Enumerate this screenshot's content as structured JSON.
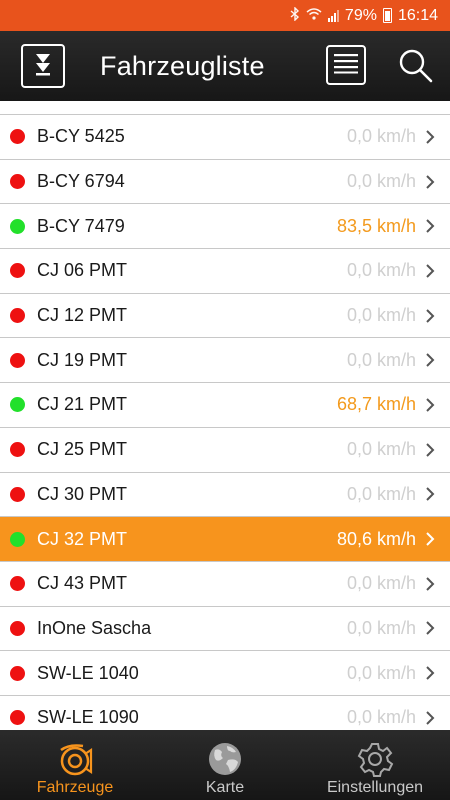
{
  "statusbar": {
    "battery": "79%",
    "time": "16:14"
  },
  "appbar": {
    "title": "Fahrzeugliste"
  },
  "vehicles": [
    {
      "name": "B-CY 5425",
      "speed": "0,0 km/h",
      "status": "stopped"
    },
    {
      "name": "B-CY 6794",
      "speed": "0,0 km/h",
      "status": "stopped"
    },
    {
      "name": "B-CY 7479",
      "speed": "83,5 km/h",
      "status": "moving"
    },
    {
      "name": "CJ 06 PMT",
      "speed": "0,0 km/h",
      "status": "stopped"
    },
    {
      "name": "CJ 12 PMT",
      "speed": "0,0 km/h",
      "status": "stopped"
    },
    {
      "name": "CJ 19 PMT",
      "speed": "0,0 km/h",
      "status": "stopped"
    },
    {
      "name": "CJ 21 PMT",
      "speed": "68,7 km/h",
      "status": "moving"
    },
    {
      "name": "CJ 25 PMT",
      "speed": "0,0 km/h",
      "status": "stopped"
    },
    {
      "name": "CJ 30 PMT",
      "speed": "0,0 km/h",
      "status": "stopped"
    },
    {
      "name": "CJ 32 PMT",
      "speed": "80,6 km/h",
      "status": "moving",
      "selected": true
    },
    {
      "name": "CJ 43 PMT",
      "speed": "0,0 km/h",
      "status": "stopped"
    },
    {
      "name": "InOne Sascha",
      "speed": "0,0 km/h",
      "status": "stopped"
    },
    {
      "name": "SW-LE 1040",
      "speed": "0,0 km/h",
      "status": "stopped"
    },
    {
      "name": "SW-LE 1090",
      "speed": "0,0 km/h",
      "status": "stopped"
    }
  ],
  "status_colors": {
    "moving": "#22e02b",
    "stopped": "#ee1111"
  },
  "accent_color": "#f7941d",
  "bottomnav": {
    "tabs": [
      {
        "label": "Fahrzeuge",
        "icon": "horn-icon",
        "active": true
      },
      {
        "label": "Karte",
        "icon": "globe-icon",
        "active": false
      },
      {
        "label": "Einstellungen",
        "icon": "gear-icon",
        "active": false
      }
    ]
  }
}
